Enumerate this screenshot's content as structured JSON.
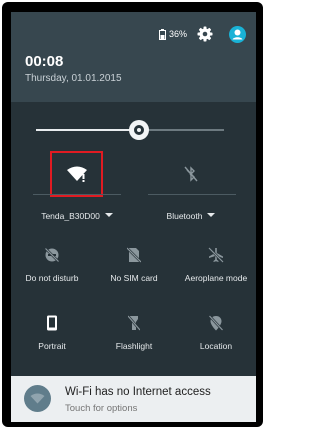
{
  "status": {
    "battery": "36%"
  },
  "header": {
    "time": "00:08",
    "date": "Thursday, 01.01.2015"
  },
  "brightness": {
    "level": 0.55
  },
  "tiles": {
    "wifi": {
      "label": "Tenda_B30D00",
      "icon": "wifi-icon"
    },
    "bluetooth": {
      "label": "Bluetooth",
      "icon": "bluetooth-off-icon"
    },
    "dnd": {
      "label": "Do not disturb",
      "icon": "do-not-disturb-icon"
    },
    "sim": {
      "label": "No SIM card",
      "icon": "no-sim-icon"
    },
    "aeroplane": {
      "label": "Aeroplane mode",
      "icon": "aeroplane-icon"
    },
    "portrait": {
      "label": "Portrait",
      "icon": "portrait-icon"
    },
    "flashlight": {
      "label": "Flashlight",
      "icon": "flashlight-icon"
    },
    "location": {
      "label": "Location",
      "icon": "location-off-icon"
    }
  },
  "notification": {
    "title": "Wi-Fi has no Internet access",
    "subtitle": "Touch for options",
    "icon": "wifi-alert-icon"
  },
  "colors": {
    "header": "#37474f",
    "panel": "#263238",
    "accent": "#19b2d6",
    "highlight": "#e11b22"
  }
}
